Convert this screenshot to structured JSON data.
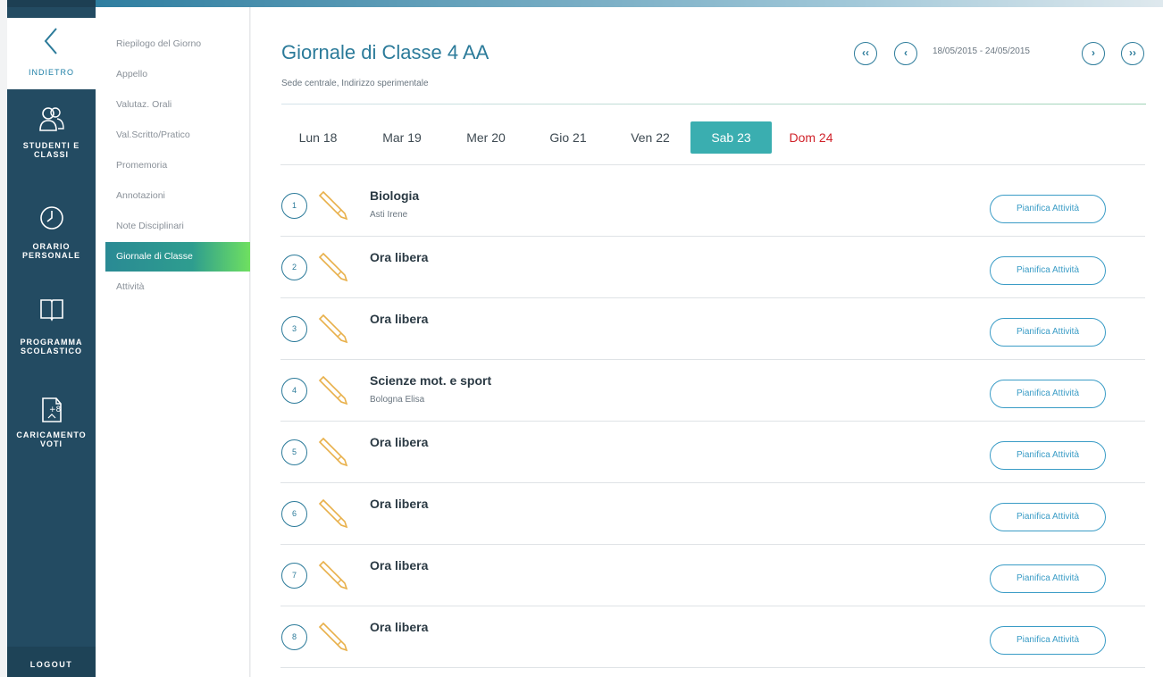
{
  "nav": {
    "back_label": "INDIETRO",
    "items": [
      {
        "label_1": "STUDENTI E",
        "label_2": "CLASSI",
        "icon": "users-icon"
      },
      {
        "label_1": "ORARIO",
        "label_2": "PERSONALE",
        "icon": "clock-icon"
      },
      {
        "label_1": "PROGRAMMA",
        "label_2": "SCOLASTICO",
        "icon": "book-icon"
      },
      {
        "label_1": "CARICAMENTO",
        "label_2": "VOTI",
        "icon": "upload-grades-icon"
      }
    ],
    "logout_label": "LOGOUT"
  },
  "submenu": {
    "items": [
      {
        "label": "Riepilogo del Giorno"
      },
      {
        "label": "Appello"
      },
      {
        "label": "Valutaz. Orali"
      },
      {
        "label": "Val.Scritto/Pratico"
      },
      {
        "label": "Promemoria"
      },
      {
        "label": "Annotazioni"
      },
      {
        "label": "Note Disciplinari"
      },
      {
        "label": "Giornale di Classe"
      },
      {
        "label": "Attività"
      }
    ],
    "active_index": 7
  },
  "header": {
    "title": "Giornale di Classe 4 AA",
    "subtitle": "Sede centrale, Indirizzo sperimentale",
    "date_range": "18/05/2015 - 24/05/2015",
    "prev_prev": "‹‹",
    "prev": "‹",
    "next": "›",
    "next_next": "››"
  },
  "days": [
    {
      "label": "Lun 18"
    },
    {
      "label": "Mar 19"
    },
    {
      "label": "Mer 20"
    },
    {
      "label": "Gio 21"
    },
    {
      "label": "Ven 22"
    },
    {
      "label": "Sab 23",
      "active": true
    },
    {
      "label": "Dom 24",
      "sunday": true
    }
  ],
  "lessons": [
    {
      "num": "1",
      "subject": "Biologia",
      "teacher": "Asti Irene",
      "action": "Pianifica Attività"
    },
    {
      "num": "2",
      "subject": "Ora libera",
      "teacher": "",
      "action": "Pianifica Attività"
    },
    {
      "num": "3",
      "subject": "Ora libera",
      "teacher": "",
      "action": "Pianifica Attività"
    },
    {
      "num": "4",
      "subject": "Scienze mot. e sport",
      "teacher": "Bologna Elisa",
      "action": "Pianifica Attività"
    },
    {
      "num": "5",
      "subject": "Ora libera",
      "teacher": "",
      "action": "Pianifica Attività"
    },
    {
      "num": "6",
      "subject": "Ora libera",
      "teacher": "",
      "action": "Pianifica Attività"
    },
    {
      "num": "7",
      "subject": "Ora libera",
      "teacher": "",
      "action": "Pianifica Attività"
    },
    {
      "num": "8",
      "subject": "Ora libera",
      "teacher": "",
      "action": "Pianifica Attività"
    }
  ],
  "colors": {
    "nav_bg": "#234b62",
    "accent": "#2c7b9a",
    "active_day": "#3aaeb0",
    "sunday": "#d0222a",
    "pencil": "#e8b04a"
  }
}
